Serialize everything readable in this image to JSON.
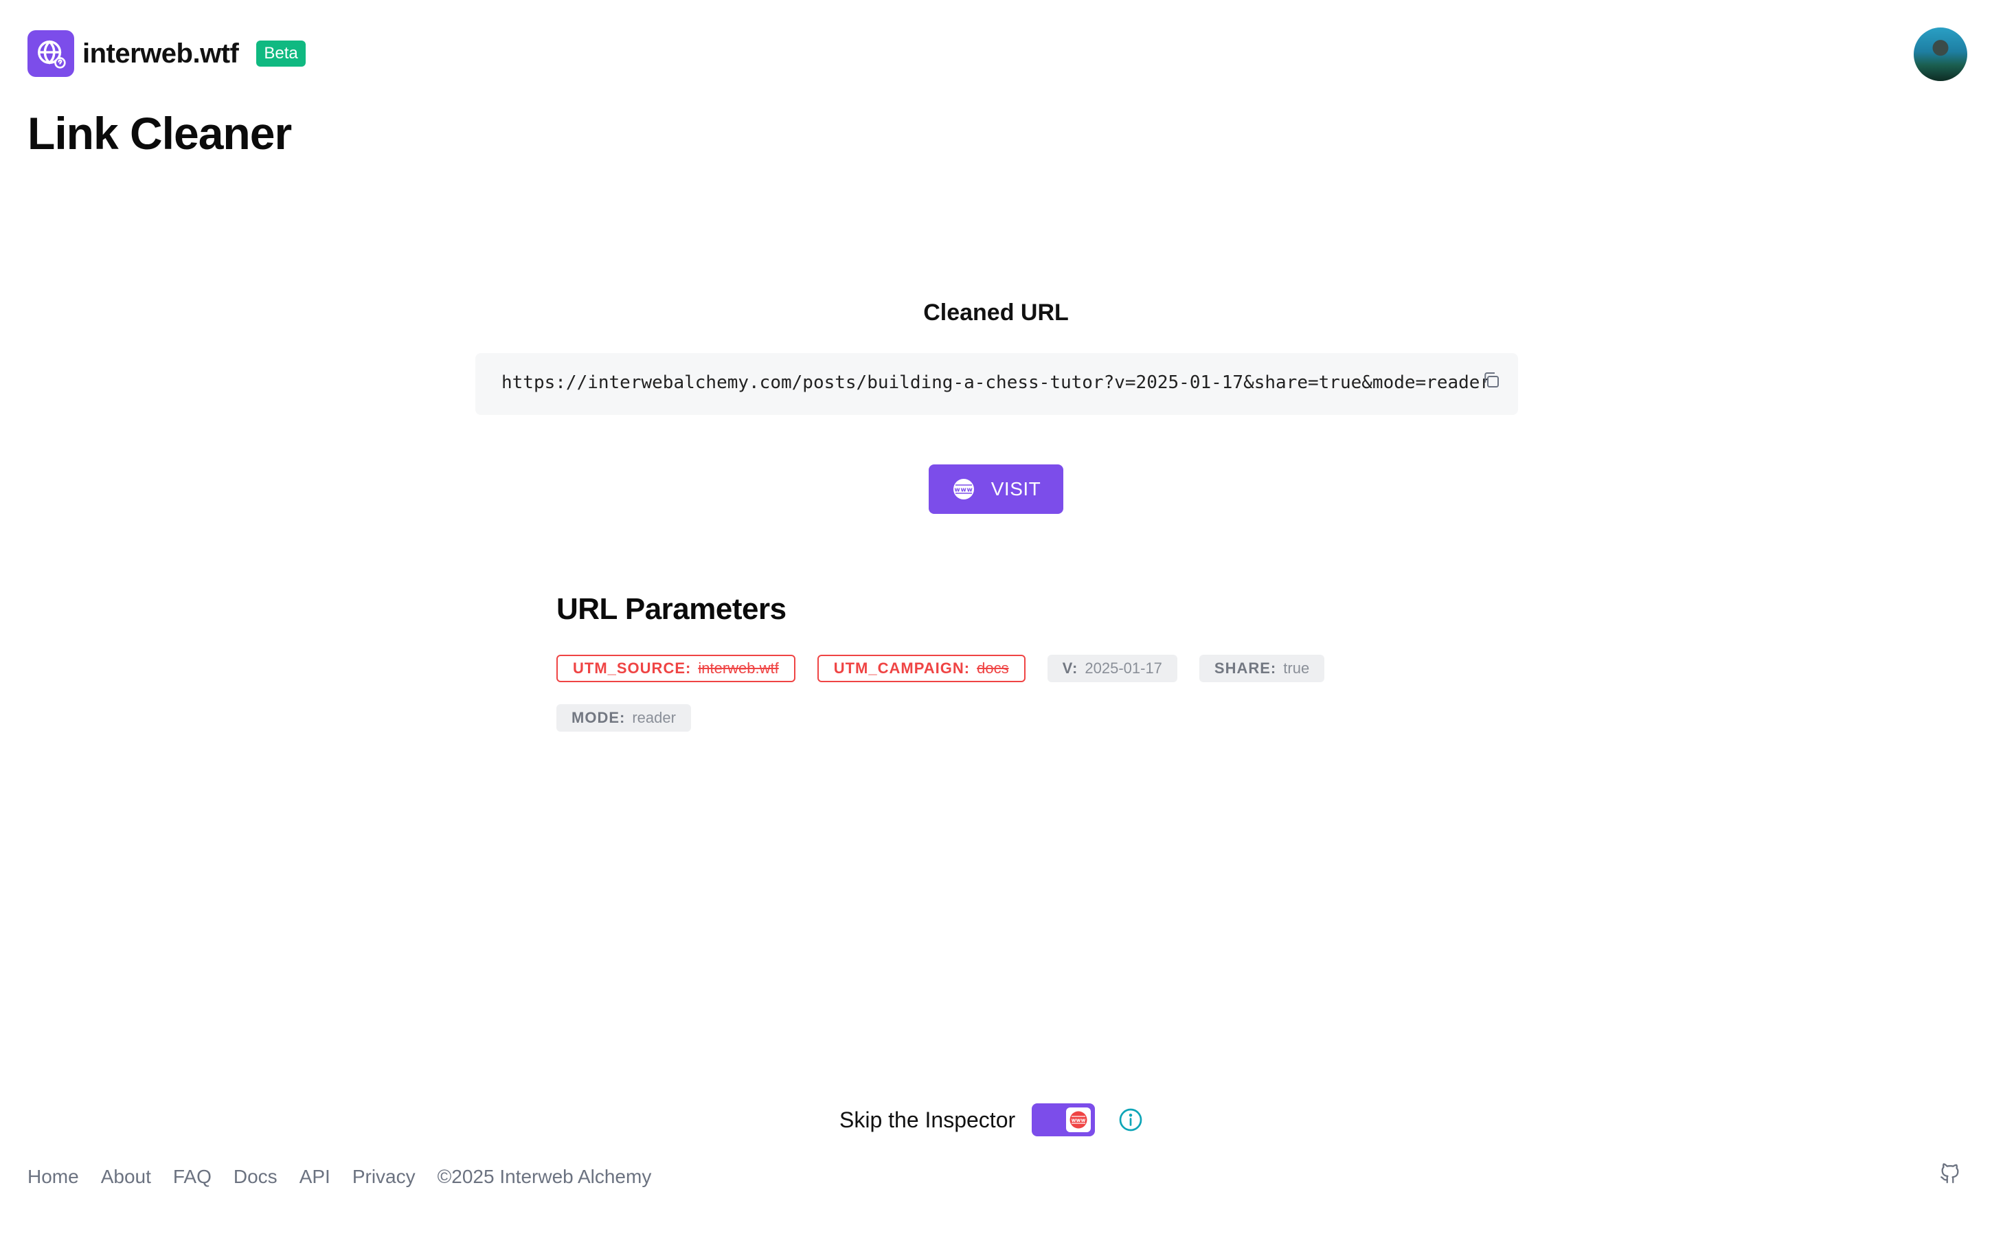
{
  "header": {
    "brand": "interweb.wtf",
    "badge": "Beta",
    "logo_icon": "globe-question-icon",
    "avatar": "user-avatar"
  },
  "page": {
    "title": "Link Cleaner"
  },
  "cleaned": {
    "title": "Cleaned URL",
    "url": "https://interwebalchemy.com/posts/building-a-chess-tutor?v=2025-01-17&share=true&mode=reader",
    "copy_icon": "copy-icon"
  },
  "visit": {
    "label": "VISIT",
    "icon": "www-globe-icon"
  },
  "params": {
    "title": "URL Parameters",
    "items": [
      {
        "key": "UTM_SOURCE:",
        "value": "interweb.wtf",
        "removed": true
      },
      {
        "key": "UTM_CAMPAIGN:",
        "value": "docs",
        "removed": true
      },
      {
        "key": "V:",
        "value": "2025-01-17",
        "removed": false
      },
      {
        "key": "SHARE:",
        "value": "true",
        "removed": false
      },
      {
        "key": "MODE:",
        "value": "reader",
        "removed": false
      }
    ]
  },
  "skip": {
    "label": "Skip the Inspector",
    "toggle_on": true,
    "info_icon": "info-icon"
  },
  "footer": {
    "links": [
      "Home",
      "About",
      "FAQ",
      "Docs",
      "API",
      "Privacy"
    ],
    "copyright": "©2025 Interweb Alchemy",
    "github_icon": "github-icon"
  },
  "colors": {
    "accent": "#7c4dea",
    "beta": "#10b981",
    "removed": "#ef4444",
    "info": "#0ea5b7"
  }
}
